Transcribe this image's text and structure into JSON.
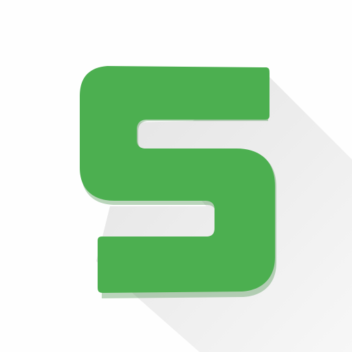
{
  "app_icon": {
    "name": "s-letter-logo",
    "letter": "S",
    "colors": {
      "background": "#fefefe",
      "letter_fill": "#4caf50",
      "long_shadow": "#e6e6e6",
      "edge_shadow": "#3b8a3f"
    }
  }
}
